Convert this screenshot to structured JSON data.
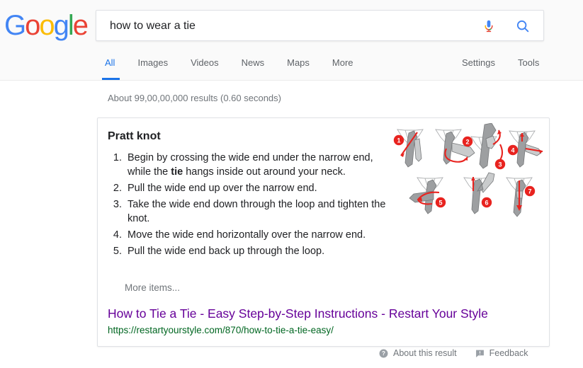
{
  "brand": {
    "logo_letters": [
      {
        "ch": "G",
        "color": "#4285F4"
      },
      {
        "ch": "o",
        "color": "#EA4335"
      },
      {
        "ch": "o",
        "color": "#FBBC05"
      },
      {
        "ch": "g",
        "color": "#4285F4"
      },
      {
        "ch": "l",
        "color": "#34A853"
      },
      {
        "ch": "e",
        "color": "#EA4335"
      }
    ]
  },
  "search": {
    "query": "how to wear a tie",
    "placeholder": "Search",
    "mic_icon": "microphone-icon",
    "search_icon": "search-icon"
  },
  "nav": {
    "tabs": [
      {
        "label": "All",
        "active": true
      },
      {
        "label": "Images",
        "active": false
      },
      {
        "label": "Videos",
        "active": false
      },
      {
        "label": "News",
        "active": false
      },
      {
        "label": "Maps",
        "active": false
      },
      {
        "label": "More",
        "active": false
      }
    ],
    "tools": [
      {
        "label": "Settings"
      },
      {
        "label": "Tools"
      }
    ]
  },
  "results": {
    "stats": "About 99,00,00,000 results (0.60 seconds)"
  },
  "featured_snippet": {
    "title": "Pratt knot",
    "steps": [
      {
        "text_before": "Begin by crossing the wide end under the narrow end, while the ",
        "bold": "tie",
        "text_after": " hangs inside out around your neck."
      },
      {
        "text_before": "Pull the wide end up over the narrow end.",
        "bold": "",
        "text_after": ""
      },
      {
        "text_before": "Take the wide end down through the loop and tighten the knot.",
        "bold": "",
        "text_after": ""
      },
      {
        "text_before": "Move the wide end horizontally over the narrow end.",
        "bold": "",
        "text_after": ""
      },
      {
        "text_before": "Pull the wide end back up through the loop.",
        "bold": "",
        "text_after": ""
      }
    ],
    "more_items": "More items...",
    "result_title": "How to Tie a Tie - Easy Step-by-Step Instructions - Restart Your Style",
    "result_url": "https://restartyourstyle.com/870/how-to-tie-a-tie-easy/",
    "diagram": {
      "alt": "tie-knot-steps-illustration",
      "badge_color": "#e8231f",
      "tie_color": "#9a9a9a",
      "step_badges": [
        "1",
        "2",
        "3",
        "4",
        "5",
        "6",
        "7"
      ]
    }
  },
  "footer": {
    "about_label": "About this result",
    "about_icon": "question-circle-icon",
    "feedback_label": "Feedback",
    "feedback_icon": "feedback-icon"
  },
  "colors": {
    "link_visited": "#660099",
    "url_green": "#006621",
    "accent_blue": "#1a73e8",
    "text_gray": "#70757a"
  }
}
